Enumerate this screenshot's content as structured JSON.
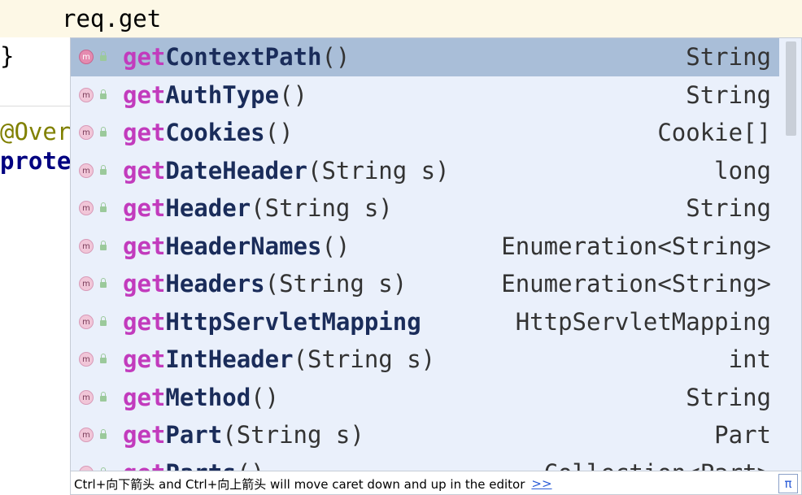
{
  "editor": {
    "typed": "req.get",
    "brace": "}",
    "annotation": "@Over",
    "keyword": "prote"
  },
  "completion": {
    "items": [
      {
        "match": "get",
        "rest": "ContextPath",
        "params": "()",
        "type": "String",
        "selected": true
      },
      {
        "match": "get",
        "rest": "AuthType",
        "params": "()",
        "type": "String"
      },
      {
        "match": "get",
        "rest": "Cookies",
        "params": "()",
        "type": "Cookie[]"
      },
      {
        "match": "get",
        "rest": "DateHeader",
        "params": "(String s)",
        "type": "long"
      },
      {
        "match": "get",
        "rest": "Header",
        "params": "(String s)",
        "type": "String"
      },
      {
        "match": "get",
        "rest": "HeaderNames",
        "params": "()",
        "type": "Enumeration<String>"
      },
      {
        "match": "get",
        "rest": "Headers",
        "params": "(String s)",
        "type": "Enumeration<String>"
      },
      {
        "match": "get",
        "rest": "HttpServletMapping",
        "params": "",
        "type": "HttpServletMapping"
      },
      {
        "match": "get",
        "rest": "IntHeader",
        "params": "(String s)",
        "type": "int"
      },
      {
        "match": "get",
        "rest": "Method",
        "params": "()",
        "type": "String"
      },
      {
        "match": "get",
        "rest": "Part",
        "params": "(String s)",
        "type": "Part"
      },
      {
        "match": "get",
        "rest": "Parts",
        "params": "()",
        "type": "Collection<Part>"
      }
    ],
    "icon_names": [
      "method-icon",
      "lock-icon"
    ],
    "footer_text": "Ctrl+向下箭头 and Ctrl+向上箭头 will move caret down and up in the editor",
    "footer_link": ">>",
    "pi_label": "π"
  },
  "colors": {
    "selection": "#a9bed8",
    "popup_bg": "#eaf0fb",
    "match": "#c23bbd"
  }
}
